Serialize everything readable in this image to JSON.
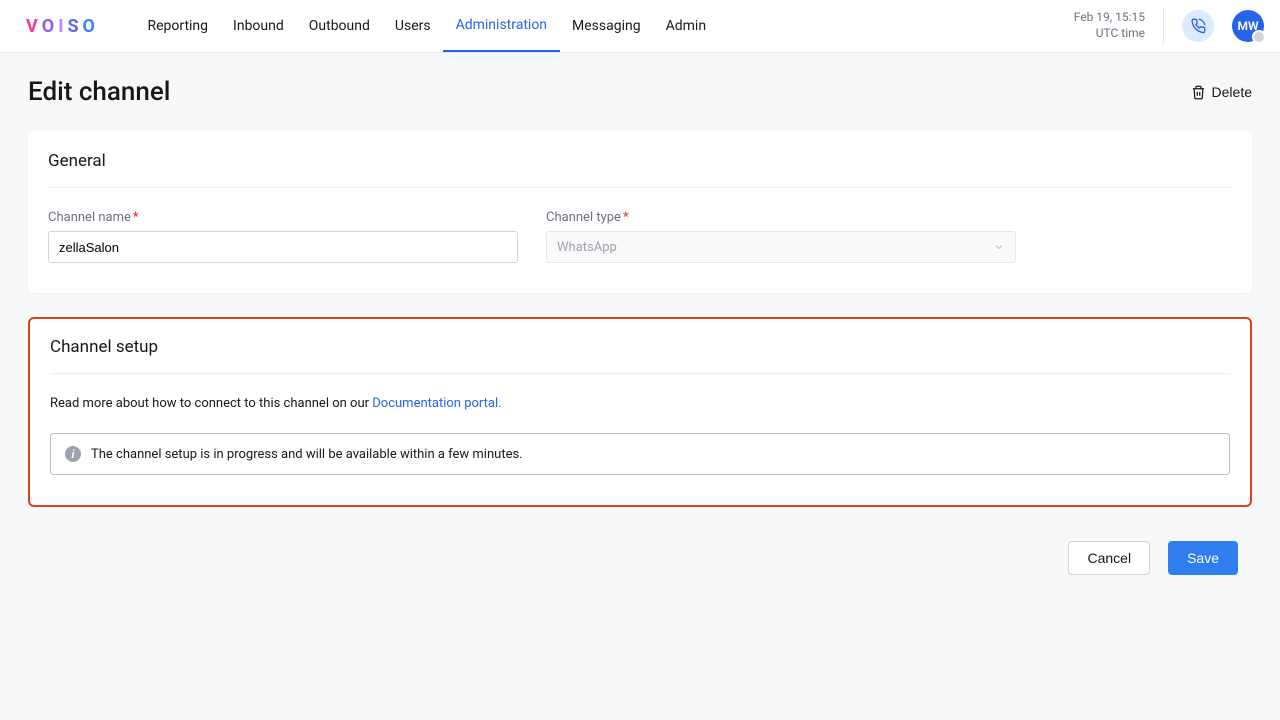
{
  "header": {
    "logo_letters": [
      "V",
      "O",
      "I",
      "S",
      "O"
    ],
    "nav": [
      "Reporting",
      "Inbound",
      "Outbound",
      "Users",
      "Administration",
      "Messaging",
      "Admin"
    ],
    "active_nav_index": 4,
    "date": "Feb 19, 15:15",
    "tz": "UTC time",
    "avatar_initials": "MW"
  },
  "page": {
    "title": "Edit channel",
    "delete_label": "Delete"
  },
  "general": {
    "section_title": "General",
    "channel_name_label": "Channel name",
    "channel_name_value": "zellaSalon",
    "channel_type_label": "Channel type",
    "channel_type_value": "WhatsApp"
  },
  "setup": {
    "section_title": "Channel setup",
    "help_prefix": "Read more about how to connect to this channel on our ",
    "help_link_label": "Documentation portal.",
    "info_message": "The channel setup is in progress and will be available within a few minutes."
  },
  "actions": {
    "cancel": "Cancel",
    "save": "Save"
  }
}
